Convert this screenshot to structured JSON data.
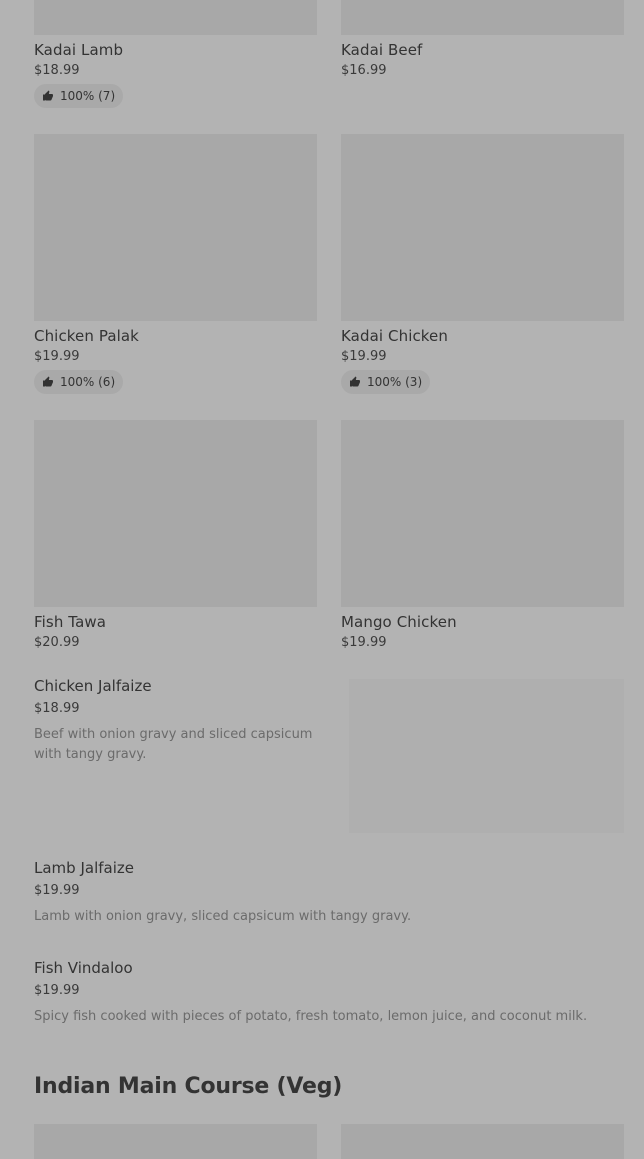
{
  "grid_items": [
    {
      "name": "Kadai Lamb",
      "price": "$18.99",
      "rating": "100% (7)"
    },
    {
      "name": "Kadai Beef",
      "price": "$16.99"
    },
    {
      "name": "Chicken Palak",
      "price": "$19.99",
      "rating": "100% (6)"
    },
    {
      "name": "Kadai Chicken",
      "price": "$19.99",
      "rating": "100% (3)"
    },
    {
      "name": "Fish Tawa",
      "price": "$20.99"
    },
    {
      "name": "Mango Chicken",
      "price": "$19.99"
    }
  ],
  "list_items": [
    {
      "name": "Chicken Jalfaize",
      "price": "$18.99",
      "description": "Beef with onion gravy and sliced capsicum with tangy gravy."
    },
    {
      "name": "Lamb Jalfaize",
      "price": "$19.99",
      "description": "Lamb with onion gravy, sliced capsicum with tangy gravy."
    },
    {
      "name": "Fish Vindaloo",
      "price": "$19.99",
      "description": "Spicy fish cooked with pieces of potato, fresh tomato, lemon juice, and coconut milk."
    }
  ],
  "section_heading": "Indian Main Course (Veg)",
  "icons": {
    "rating": "thumbs-up-icon"
  },
  "colors": {
    "background": "#b3b3b3",
    "image_placeholder": "#a8a8a8",
    "rating_pill": "#a9a9a9",
    "text": "#333333",
    "muted_text": "#6b6b6b"
  }
}
